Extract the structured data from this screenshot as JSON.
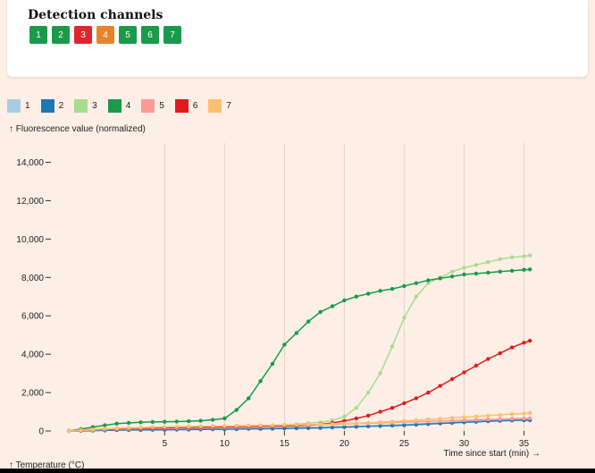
{
  "header": {
    "title": "Detection channels",
    "chips": [
      {
        "label": "1",
        "color": "#1a9a4b"
      },
      {
        "label": "2",
        "color": "#1a9a4b"
      },
      {
        "label": "3",
        "color": "#e0262c"
      },
      {
        "label": "4",
        "color": "#e98228"
      },
      {
        "label": "5",
        "color": "#1a9a4b"
      },
      {
        "label": "6",
        "color": "#1a9a4b"
      },
      {
        "label": "7",
        "color": "#1a9a4b"
      }
    ]
  },
  "chart_data": {
    "type": "line",
    "ylabel": "↑ Fluorescence value (normalized)",
    "xlabel": "Time since start (min) →",
    "secondary_label": "↑ Temperature (°C)",
    "xlim": [
      -4.5,
      37.5
    ],
    "ylim": [
      0,
      15000
    ],
    "xticks": [
      5,
      10,
      15,
      20,
      25,
      30,
      35
    ],
    "yticks": [
      0,
      2000,
      4000,
      6000,
      8000,
      10000,
      12000,
      14000
    ],
    "ytick_labels": [
      "0",
      "2,000",
      "4,000",
      "6,000",
      "8,000",
      "10,000",
      "12,000",
      "14,000"
    ],
    "x": [
      -3,
      -2,
      -1,
      0,
      1,
      2,
      3,
      4,
      5,
      6,
      7,
      8,
      9,
      10,
      11,
      12,
      13,
      14,
      15,
      16,
      17,
      18,
      19,
      20,
      21,
      22,
      23,
      24,
      25,
      26,
      27,
      28,
      29,
      30,
      31,
      32,
      33,
      34,
      35,
      35.5
    ],
    "series": [
      {
        "name": "1",
        "color": "#a6cee3",
        "values": [
          0,
          20,
          40,
          50,
          60,
          70,
          80,
          90,
          100,
          100,
          110,
          120,
          120,
          130,
          140,
          150,
          160,
          170,
          180,
          190,
          200,
          210,
          220,
          230,
          250,
          270,
          290,
          310,
          340,
          370,
          400,
          430,
          460,
          490,
          520,
          540,
          560,
          580,
          600,
          600
        ]
      },
      {
        "name": "2",
        "color": "#1f78b4",
        "values": [
          0,
          0,
          20,
          30,
          40,
          50,
          50,
          60,
          60,
          70,
          70,
          80,
          90,
          90,
          100,
          110,
          110,
          120,
          130,
          140,
          150,
          160,
          180,
          200,
          220,
          240,
          260,
          280,
          300,
          330,
          360,
          390,
          420,
          450,
          480,
          510,
          530,
          550,
          560,
          560
        ]
      },
      {
        "name": "3",
        "color": "#a8dc8f",
        "values": [
          0,
          30,
          60,
          80,
          100,
          120,
          140,
          160,
          170,
          180,
          190,
          200,
          210,
          220,
          230,
          250,
          270,
          290,
          320,
          350,
          400,
          450,
          550,
          750,
          1200,
          2000,
          3000,
          4400,
          5900,
          7000,
          7700,
          8000,
          8300,
          8500,
          8650,
          8800,
          8950,
          9050,
          9100,
          9150
        ]
      },
      {
        "name": "4",
        "color": "#1a9a4b",
        "values": [
          0,
          100,
          200,
          300,
          380,
          420,
          450,
          470,
          480,
          490,
          510,
          530,
          580,
          650,
          1100,
          1700,
          2600,
          3500,
          4500,
          5100,
          5700,
          6200,
          6500,
          6800,
          7000,
          7150,
          7300,
          7400,
          7550,
          7700,
          7850,
          7950,
          8050,
          8150,
          8200,
          8250,
          8300,
          8350,
          8400,
          8420
        ]
      },
      {
        "name": "5",
        "color": "#fb9a99",
        "values": [
          0,
          30,
          60,
          80,
          100,
          110,
          120,
          130,
          140,
          140,
          150,
          160,
          170,
          180,
          190,
          200,
          220,
          240,
          260,
          280,
          300,
          320,
          340,
          360,
          380,
          400,
          420,
          440,
          460,
          480,
          500,
          520,
          540,
          560,
          580,
          600,
          620,
          640,
          650,
          660
        ]
      },
      {
        "name": "6",
        "color": "#e31a1c",
        "values": [
          0,
          40,
          80,
          100,
          120,
          140,
          150,
          160,
          170,
          180,
          190,
          200,
          210,
          220,
          230,
          240,
          250,
          260,
          270,
          280,
          300,
          350,
          420,
          520,
          650,
          800,
          1000,
          1200,
          1450,
          1700,
          2000,
          2350,
          2700,
          3050,
          3400,
          3750,
          4050,
          4350,
          4600,
          4700
        ]
      },
      {
        "name": "7",
        "color": "#fdbf6f",
        "values": [
          0,
          40,
          80,
          110,
          140,
          160,
          180,
          200,
          210,
          220,
          230,
          240,
          250,
          260,
          270,
          280,
          290,
          300,
          310,
          320,
          330,
          340,
          360,
          380,
          400,
          430,
          460,
          490,
          520,
          560,
          600,
          640,
          680,
          720,
          760,
          800,
          840,
          880,
          910,
          930
        ]
      }
    ]
  }
}
